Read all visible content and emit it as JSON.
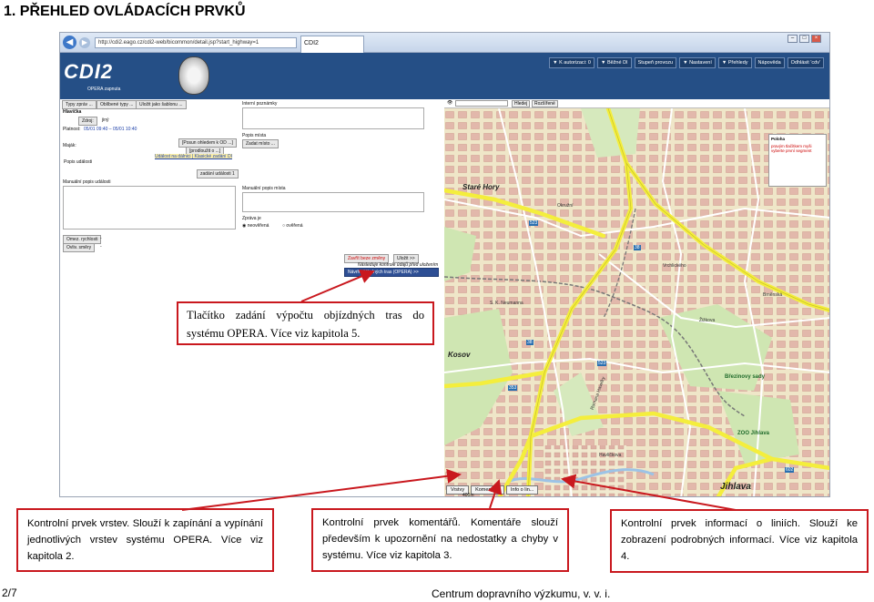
{
  "heading": "1. PŘEHLED OVLÁDACÍCH PRVKŮ",
  "screenshot": {
    "browser": {
      "url": "http://cdi2.eago.cz/cdi2-web/bicommon/detail.jsp?start_highway=1",
      "tab_title": "CDI2"
    },
    "app": {
      "logo": "CDI2",
      "opera_label": "OPERA zapnuta",
      "menu": [
        "▼ K autorizaci: 0",
        "▼ Běžné DI",
        "Stupeň provozu",
        "▼ Nastavení",
        "▼ Přehledy",
        "Nápověda",
        "Odhlásit 'cdv'"
      ]
    },
    "form": {
      "top_buttons": [
        "Typy zpráv ...",
        "Oblíbené typy ...",
        "Uložit jako šablonu ..."
      ],
      "hlavicka": "Hlavička",
      "zdroj_button": "Zdroj:",
      "zdroj_value": "jiný",
      "platnost_label": "Platnost:",
      "platnost_value": "05/01 09:40 – 05/01 10:40",
      "interni_poznamky": "Interní poznámky",
      "posun_button": "[Posun ohledem k OD ...]",
      "prodlouzit_button": "[prodloužit o ...]",
      "popis_mista": "Popis místa",
      "zadat_misto": "Zadat místo ...",
      "majak": "Maják:",
      "udalost": "Událost na dálnici | Klasické zadání DI",
      "popis_udalosti": "Popis události",
      "zadani_udalosti": "zadání události 1",
      "manualni_popis_udalosti": "Manuální popis události",
      "manualni_popis_mista": "Manuální popis místa",
      "zprava_je": "Zpráva je",
      "neoverena": "neověřená",
      "overena": "ověřená",
      "omez_rychlost": "Omez. rychlosti",
      "ovliv_smery": "Ovliv. směry",
      "dash": "-",
      "zavrit": "Zavřít beze změny",
      "ulozit": "Uložit >>",
      "nasledujici": "Následuje kontrole údajů před uložením",
      "navrh": "Návrh objízdných tras (OPERA) >>"
    },
    "map": {
      "toolbar": [
        "Hledej",
        "Rozšířené"
      ],
      "towns": [
        "Staré Hory",
        "Kosov",
        "Jihlava"
      ],
      "pois": [
        "Březinovy sady",
        "ZOO Jihlava"
      ],
      "streets": [
        "Okružní",
        "S. K. Neumanna",
        "Romana Havelky",
        "Vrchlického",
        "Žižkova",
        "Brněnská",
        "Havlíčkova"
      ],
      "road_numbers": [
        "523",
        "38",
        "38",
        "353",
        "523",
        "602"
      ],
      "legend": [
        "Poloha",
        "pravým tlačítkem myši vyberte první segment"
      ],
      "tabs": [
        "Vrstvy",
        "Komentáře",
        "Info o lin..."
      ],
      "scale": "400m"
    }
  },
  "callouts": {
    "opera": "Tlačítko zadání výpočtu objízdných tras do systému OPERA. Více viz kapitola 5.",
    "vrstvy": "Kontrolní prvek vrstev. Slouží k zapínání a vypínání jednotlivých vrstev systému OPERA. Více viz kapitola 2.",
    "komentare": "Kontrolní prvek komentářů. Komentáře slouží především k upozornění na nedostatky a chyby v systému. Více viz kapitola 3.",
    "info": "Kontrolní prvek informací o liniích. Slouží ke zobrazení podrobných informací. Více viz kapitola 4."
  },
  "footer": {
    "page": "2/7",
    "org": "Centrum dopravního výzkumu, v. v. i."
  },
  "colors": {
    "callout_border": "#c9181e",
    "header_blue": "#254f86",
    "road_yellow": "#f4ee3c"
  }
}
